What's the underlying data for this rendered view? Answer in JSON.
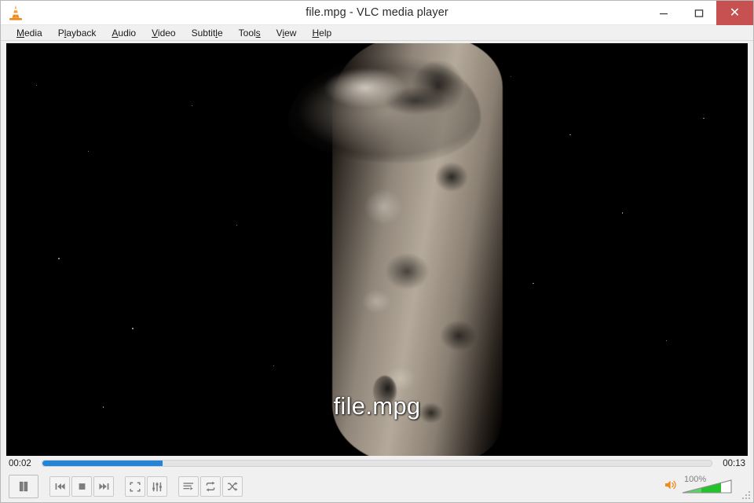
{
  "window": {
    "title": "file.mpg - VLC media player",
    "app_icon": "vlc-cone-icon",
    "minimize_label": "Minimize",
    "maximize_label": "Maximize",
    "close_label": "Close",
    "close_glyph": "✕",
    "close_color": "#c75050"
  },
  "menubar": {
    "items": [
      {
        "label": "Media",
        "mnemonic_index": 0
      },
      {
        "label": "Playback",
        "mnemonic_index": 1
      },
      {
        "label": "Audio",
        "mnemonic_index": 0
      },
      {
        "label": "Video",
        "mnemonic_index": 0
      },
      {
        "label": "Subtitle",
        "mnemonic_index": 6
      },
      {
        "label": "Tools",
        "mnemonic_index": 4
      },
      {
        "label": "View",
        "mnemonic_index": 1
      },
      {
        "label": "Help",
        "mnemonic_index": 0
      }
    ]
  },
  "video": {
    "subtitle_text": "file.mpg",
    "background_color": "#000000",
    "content_description": "asteroid"
  },
  "playback": {
    "elapsed": "00:02",
    "remaining": "00:13",
    "progress_percent": 18,
    "progress_fill_color": "#2485d8",
    "state": "playing"
  },
  "controls": {
    "play_pause": {
      "name": "pause-button",
      "label": "Pause"
    },
    "previous": {
      "name": "previous-button",
      "label": "Previous"
    },
    "stop": {
      "name": "stop-button",
      "label": "Stop"
    },
    "next": {
      "name": "next-button",
      "label": "Next"
    },
    "fullscreen": {
      "name": "fullscreen-button",
      "label": "Toggle fullscreen"
    },
    "settings": {
      "name": "extended-settings-button",
      "label": "Show extended settings"
    },
    "playlist": {
      "name": "playlist-button",
      "label": "Show playlist"
    },
    "loop": {
      "name": "loop-button",
      "label": "Loop"
    },
    "shuffle": {
      "name": "shuffle-button",
      "label": "Random"
    }
  },
  "volume": {
    "label": "100%",
    "level_percent": 100,
    "muted": false,
    "fill_color": "#22c32a",
    "speaker_icon": "speaker-icon"
  },
  "resize_grip": {
    "name": "resize-grip"
  }
}
